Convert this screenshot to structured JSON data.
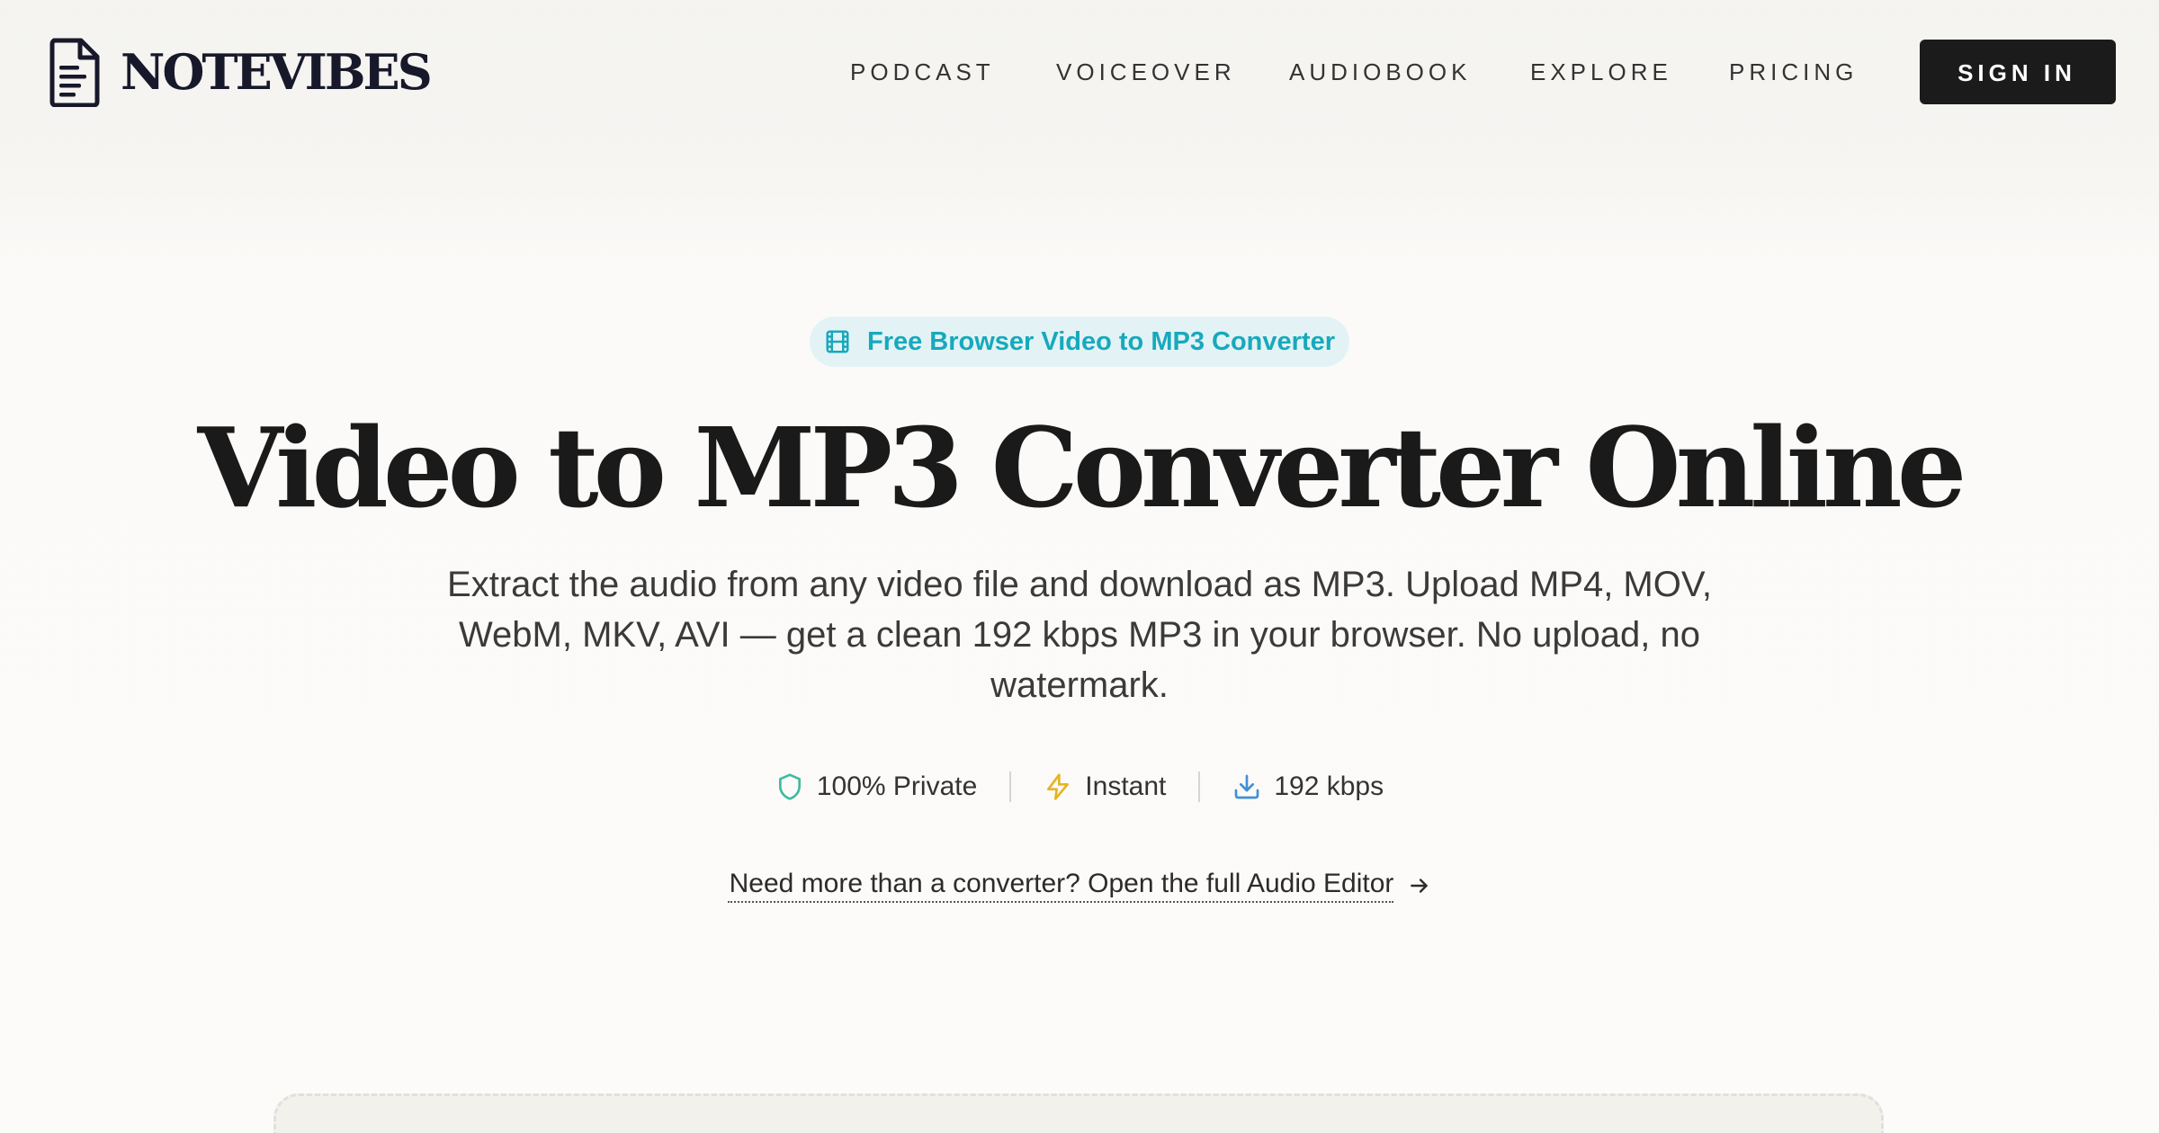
{
  "brand": {
    "name": "NOTEVIBES",
    "logo_icon": "document-icon"
  },
  "nav": {
    "items": [
      {
        "label": "PODCAST"
      },
      {
        "label": "VOICEOVER"
      },
      {
        "label": "AUDIOBOOK"
      },
      {
        "label": "EXPLORE"
      },
      {
        "label": "PRICING"
      }
    ],
    "signin_label": "SIGN IN"
  },
  "hero": {
    "badge": {
      "icon": "film-icon",
      "label": "Free Browser Video to MP3 Converter"
    },
    "title": "Video to MP3 Converter Online",
    "subtitle": "Extract the audio from any video file and download as MP3. Upload MP4, MOV, WebM, MKV, AVI — get a clean 192 kbps MP3 in your browser. No upload, no watermark."
  },
  "features": [
    {
      "icon": "shield-icon",
      "label": "100% Private",
      "color": "#3dbb9f"
    },
    {
      "icon": "lightning-icon",
      "label": "Instant",
      "color": "#e6b422"
    },
    {
      "icon": "download-icon",
      "label": "192 kbps",
      "color": "#3f8fd9"
    }
  ],
  "editor_link": {
    "label": "Need more than a converter? Open the full Audio Editor",
    "icon": "arrow-right-icon"
  },
  "colors": {
    "accent": "#17a9bd",
    "badge_bg": "#e3f3f5",
    "button_bg": "#1b1b1b",
    "text": "#1a1a1a"
  }
}
